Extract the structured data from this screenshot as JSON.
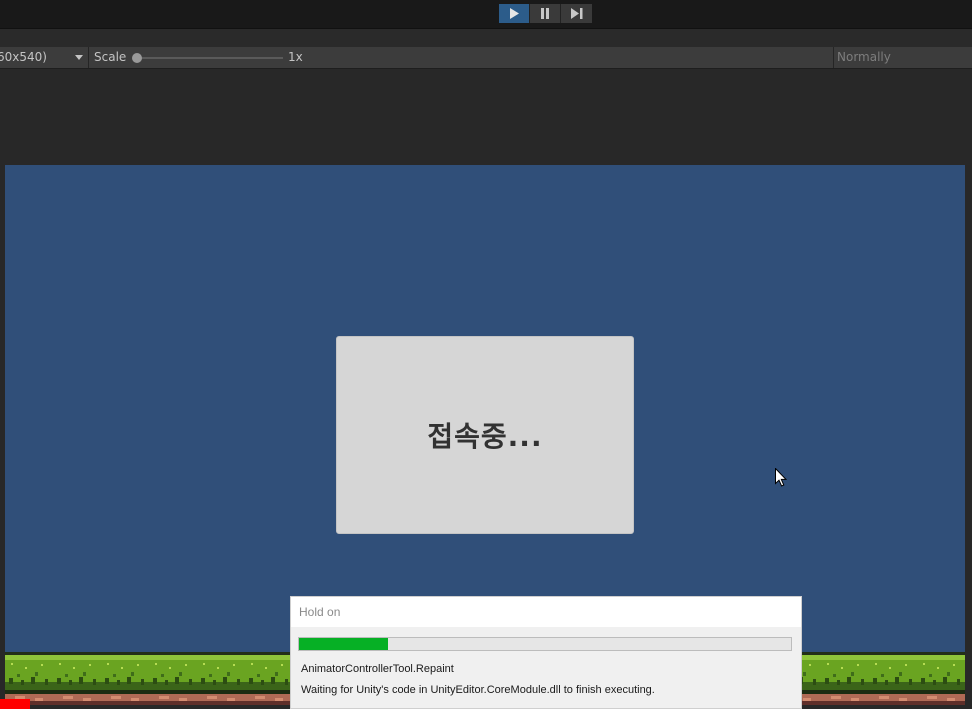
{
  "toolbar": {
    "play_icon": "play-icon",
    "pause_icon": "pause-icon",
    "step_icon": "step-icon",
    "accent": "#2c5c8a"
  },
  "game_view": {
    "resolution_label": "60x540)",
    "scale_label": "Scale",
    "scale_value": "1x",
    "scale_fraction": 0.0,
    "normally_label": "Normally"
  },
  "game": {
    "background_color": "#304f79",
    "dialog_text": "접속중..."
  },
  "progress_modal": {
    "title": "Hold on",
    "progress_fraction": 0.18,
    "progress_color": "#06b025",
    "line1": "AnimatorControllerTool.Repaint",
    "line2": "Waiting for Unity's code in UnityEditor.CoreModule.dll to finish executing."
  }
}
